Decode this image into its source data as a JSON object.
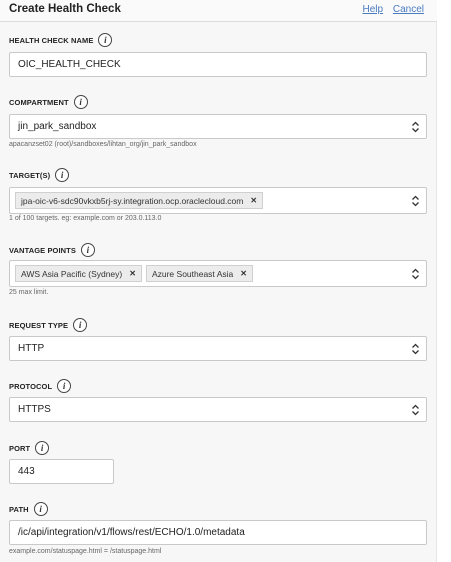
{
  "header": {
    "title": "Create Health Check",
    "help": "Help",
    "cancel": "Cancel"
  },
  "name": {
    "label": "HEALTH CHECK NAME",
    "value": "OIC_HEALTH_CHECK"
  },
  "compartment": {
    "label": "COMPARTMENT",
    "value": "jin_park_sandbox",
    "hint": "apacanzset02 (root)/sandboxes/lihtan_org/jin_park_sandbox"
  },
  "targets": {
    "label": "TARGET(S)",
    "chips": [
      "jpa-oic-v6-sdc90vkxb5rj-sy.integration.ocp.oraclecloud.com"
    ],
    "hint": "1 of 100 targets. eg: example.com or 203.0.113.0"
  },
  "vantage": {
    "label": "VANTAGE POINTS",
    "chips": [
      "AWS Asia Pacific (Sydney)",
      "Azure Southeast Asia"
    ],
    "hint": "25 max limit."
  },
  "request_type": {
    "label": "REQUEST TYPE",
    "value": "HTTP"
  },
  "protocol": {
    "label": "PROTOCOL",
    "value": "HTTPS"
  },
  "port": {
    "label": "PORT",
    "value": "443"
  },
  "path": {
    "label": "PATH",
    "value": "/ic/api/integration/v1/flows/rest/ECHO/1.0/metadata",
    "hint": "example.com/statuspage.html = /statuspage.html"
  },
  "icons": {
    "info": "info-icon",
    "chevron": "chevron-up-down-icon",
    "remove": "close-icon"
  },
  "colors": {
    "link": "#4a7cc0"
  }
}
